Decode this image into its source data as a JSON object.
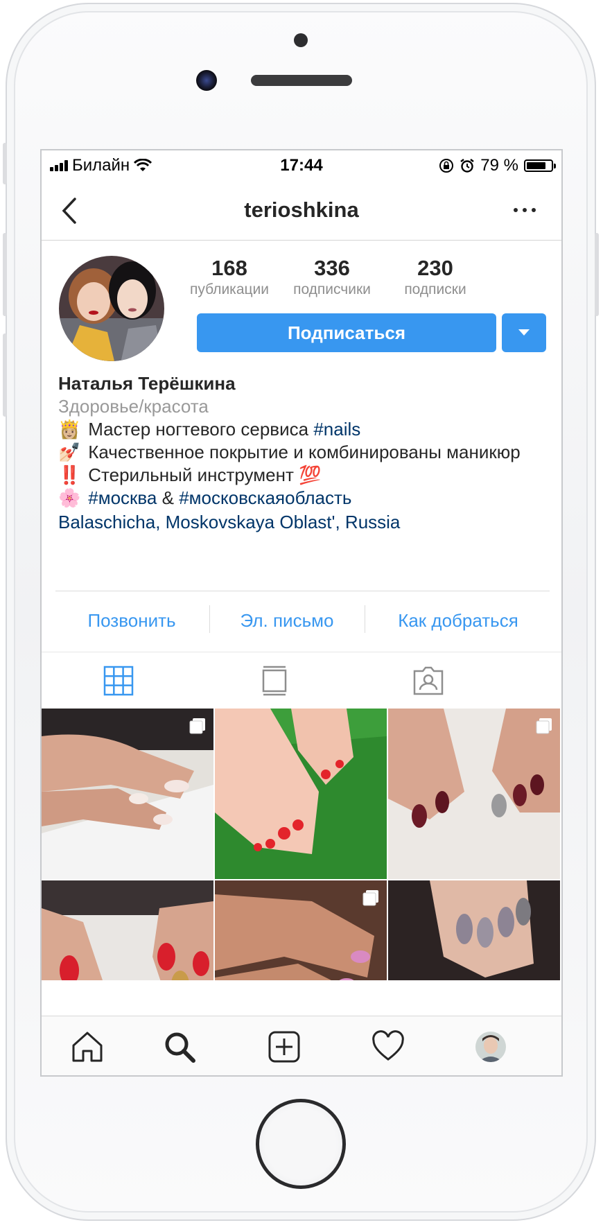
{
  "status": {
    "carrier": "Билайн",
    "time": "17:44",
    "battery": "79 %",
    "battery_level": 0.79
  },
  "nav": {
    "title": "terioshkina",
    "back_icon": "chevron-left-icon",
    "more_icon": "more-horizontal-icon"
  },
  "stats": [
    {
      "count": "168",
      "label": "публикации"
    },
    {
      "count": "336",
      "label": "подписчики"
    },
    {
      "count": "230",
      "label": "подписки"
    }
  ],
  "follow_label": "Подписаться",
  "bio": {
    "name": "Наталья Терёшкина",
    "category": "Здоровье/красота",
    "line1_text": "Мастер ногтевого сервиса",
    "line1_tag": "#nails",
    "line2_text": "Качественное покрытие и комбинированы маникюр",
    "line3_text": "Стерильный инструмент",
    "line4_tag1": "#москва",
    "line4_amp": "&",
    "line4_tag2": "#московскаяобласть",
    "location": "Balaschicha, Moskovskaya Oblast', Russia",
    "emoji1": "👸🏼",
    "emoji2": "💅🏻",
    "emoji3": "‼️",
    "emoji3b": "💯",
    "emoji4": "🌸"
  },
  "contact": {
    "call": "Позвонить",
    "email": "Эл. письмо",
    "directions": "Как добраться"
  },
  "tabs": [
    "grid-icon",
    "feed-icon",
    "tagged-icon"
  ],
  "grid_posts": [
    {
      "subject": "french-manicure",
      "multi": true
    },
    {
      "subject": "red-pedicure-on-grass",
      "multi": false
    },
    {
      "subject": "burgundy-silver-nails",
      "multi": true
    },
    {
      "subject": "red-gold-nails",
      "multi": false
    },
    {
      "subject": "pink-manicure",
      "multi": true
    },
    {
      "subject": "grey-glitter-nails",
      "multi": false
    }
  ],
  "bottom_nav": [
    "home-icon",
    "search-icon",
    "add-post-icon",
    "heart-icon",
    "profile-avatar"
  ],
  "colors": {
    "accent": "#3897f0",
    "hashtag": "#003569",
    "muted": "#8e8e8e"
  }
}
